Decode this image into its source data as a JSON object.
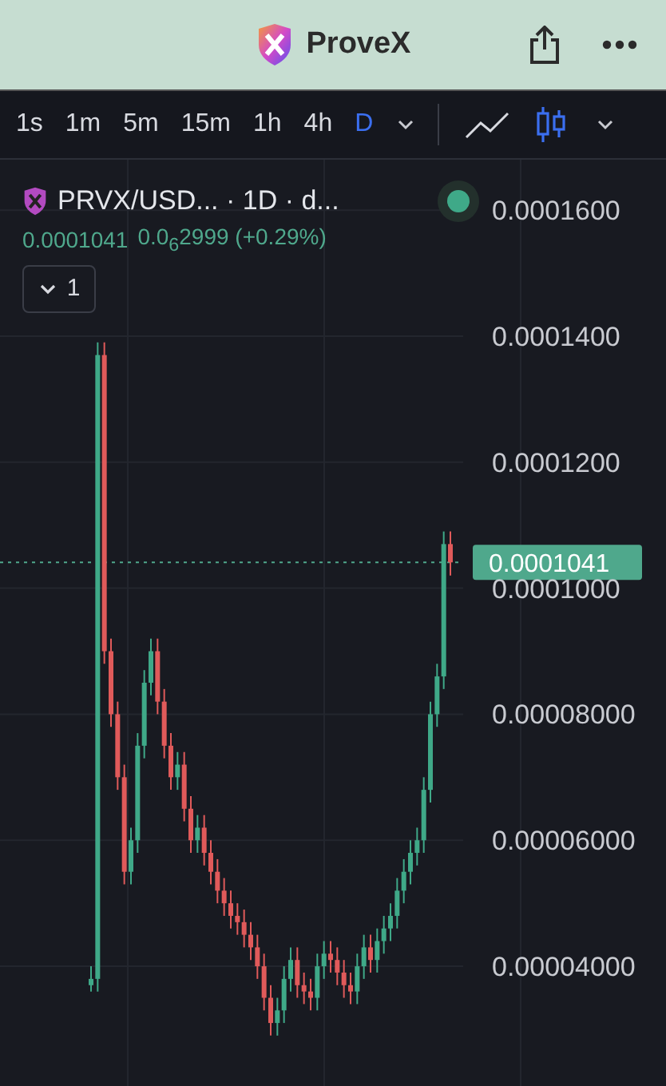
{
  "header": {
    "title": "ProveX"
  },
  "toolbar": {
    "intervals": [
      {
        "label": "1s",
        "selected": false
      },
      {
        "label": "1m",
        "selected": false
      },
      {
        "label": "5m",
        "selected": false
      },
      {
        "label": "15m",
        "selected": false
      },
      {
        "label": "1h",
        "selected": false
      },
      {
        "label": "4h",
        "selected": false
      },
      {
        "label": "D",
        "selected": true
      }
    ]
  },
  "legend": {
    "symbol": "PRVX/USD... · 1D · d...",
    "price": "0.0001041",
    "change": "0.0$_{6}$2999 (+0.29%)",
    "indicators": "1"
  },
  "chart_data": {
    "type": "candlestick",
    "grid": true,
    "ylim": [
      2.1e-05,
      0.000168
    ],
    "yticks": [
      {
        "value": 0.00016,
        "label": "0.0001600"
      },
      {
        "value": 0.00014,
        "label": "0.0001400"
      },
      {
        "value": 0.00012,
        "label": "0.0001200"
      },
      {
        "value": 0.0001,
        "label": "0.0001000"
      },
      {
        "value": 8e-05,
        "label": "0.00008000"
      },
      {
        "value": 6e-05,
        "label": "0.00006000"
      },
      {
        "value": 4e-05,
        "label": "0.00004000"
      }
    ],
    "ref_lines": [
      {
        "axis": "y",
        "value": 0.0001041,
        "color": "#4fa88c",
        "label": "0.0001041"
      }
    ],
    "ohlc": [
      [
        3.7e-05,
        4e-05,
        3.6e-05,
        3.8e-05
      ],
      [
        3.8e-05,
        0.000139,
        3.6e-05,
        0.000137
      ],
      [
        0.000137,
        0.000139,
        8.8e-05,
        9e-05
      ],
      [
        9e-05,
        9.2e-05,
        7.8e-05,
        8e-05
      ],
      [
        8e-05,
        8.2e-05,
        6.8e-05,
        7e-05
      ],
      [
        7e-05,
        7.2e-05,
        5.3e-05,
        5.5e-05
      ],
      [
        5.5e-05,
        6.2e-05,
        5.3e-05,
        6e-05
      ],
      [
        6e-05,
        7.7e-05,
        5.8e-05,
        7.5e-05
      ],
      [
        7.5e-05,
        8.7e-05,
        7.3e-05,
        8.5e-05
      ],
      [
        8.5e-05,
        9.2e-05,
        8.3e-05,
        9e-05
      ],
      [
        9e-05,
        9.2e-05,
        8e-05,
        8.2e-05
      ],
      [
        8.2e-05,
        8.4e-05,
        7.3e-05,
        7.5e-05
      ],
      [
        7.5e-05,
        7.7e-05,
        6.8e-05,
        7e-05
      ],
      [
        7e-05,
        7.4e-05,
        6.8e-05,
        7.2e-05
      ],
      [
        7.2e-05,
        7.4e-05,
        6.3e-05,
        6.5e-05
      ],
      [
        6.5e-05,
        6.7e-05,
        5.8e-05,
        6e-05
      ],
      [
        6e-05,
        6.4e-05,
        5.8e-05,
        6.2e-05
      ],
      [
        6.2e-05,
        6.4e-05,
        5.6e-05,
        5.8e-05
      ],
      [
        5.8e-05,
        6e-05,
        5.3e-05,
        5.5e-05
      ],
      [
        5.5e-05,
        5.7e-05,
        5e-05,
        5.2e-05
      ],
      [
        5.2e-05,
        5.4e-05,
        4.8e-05,
        5e-05
      ],
      [
        5e-05,
        5.2e-05,
        4.6e-05,
        4.8e-05
      ],
      [
        4.8e-05,
        5e-05,
        4.5e-05,
        4.7e-05
      ],
      [
        4.7e-05,
        4.9e-05,
        4.3e-05,
        4.5e-05
      ],
      [
        4.5e-05,
        4.7e-05,
        4.1e-05,
        4.3e-05
      ],
      [
        4.3e-05,
        4.5e-05,
        3.8e-05,
        4e-05
      ],
      [
        4e-05,
        4.2e-05,
        3.3e-05,
        3.5e-05
      ],
      [
        3.5e-05,
        3.7e-05,
        2.9e-05,
        3.1e-05
      ],
      [
        3.1e-05,
        3.5e-05,
        2.9e-05,
        3.3e-05
      ],
      [
        3.3e-05,
        4e-05,
        3.1e-05,
        3.8e-05
      ],
      [
        3.8e-05,
        4.3e-05,
        3.6e-05,
        4.1e-05
      ],
      [
        4.1e-05,
        4.3e-05,
        3.5e-05,
        3.7e-05
      ],
      [
        3.7e-05,
        3.9e-05,
        3.4e-05,
        3.6e-05
      ],
      [
        3.6e-05,
        3.8e-05,
        3.3e-05,
        3.5e-05
      ],
      [
        3.5e-05,
        4.2e-05,
        3.3e-05,
        4e-05
      ],
      [
        4e-05,
        4.4e-05,
        3.8e-05,
        4.2e-05
      ],
      [
        4.2e-05,
        4.4e-05,
        3.9e-05,
        4.1e-05
      ],
      [
        4.1e-05,
        4.3e-05,
        3.7e-05,
        3.9e-05
      ],
      [
        3.9e-05,
        4.1e-05,
        3.5e-05,
        3.7e-05
      ],
      [
        3.7e-05,
        3.9e-05,
        3.4e-05,
        3.6e-05
      ],
      [
        3.6e-05,
        4.2e-05,
        3.4e-05,
        4e-05
      ],
      [
        4e-05,
        4.5e-05,
        3.8e-05,
        4.3e-05
      ],
      [
        4.3e-05,
        4.5e-05,
        3.9e-05,
        4.1e-05
      ],
      [
        4.1e-05,
        4.6e-05,
        3.9e-05,
        4.4e-05
      ],
      [
        4.4e-05,
        4.8e-05,
        4.2e-05,
        4.6e-05
      ],
      [
        4.6e-05,
        5e-05,
        4.4e-05,
        4.8e-05
      ],
      [
        4.8e-05,
        5.4e-05,
        4.6e-05,
        5.2e-05
      ],
      [
        5.2e-05,
        5.7e-05,
        5e-05,
        5.5e-05
      ],
      [
        5.5e-05,
        6e-05,
        5.3e-05,
        5.8e-05
      ],
      [
        5.8e-05,
        6.2e-05,
        5.6e-05,
        6e-05
      ],
      [
        6e-05,
        7e-05,
        5.8e-05,
        6.8e-05
      ],
      [
        6.8e-05,
        8.2e-05,
        6.6e-05,
        8e-05
      ],
      [
        8e-05,
        8.8e-05,
        7.8e-05,
        8.6e-05
      ],
      [
        8.6e-05,
        0.000109,
        8.4e-05,
        0.000107
      ],
      [
        0.000107,
        0.000109,
        0.000102,
        0.0001041
      ]
    ]
  }
}
